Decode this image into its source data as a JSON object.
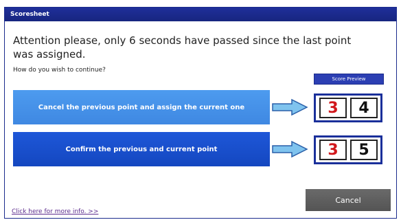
{
  "window": {
    "title": "Scoresheet"
  },
  "message": {
    "text": "Attention please, only 6 seconds have passed since the last point was assigned.",
    "question": "How do you wish to continue?"
  },
  "score_preview": {
    "label": "Score Preview",
    "option_cancel": {
      "left": "3",
      "right": "4"
    },
    "option_confirm": {
      "left": "3",
      "right": "5"
    }
  },
  "buttons": {
    "cancel_previous": "Cancel the previous point and assign the current one",
    "confirm": "Confirm the previous and current point",
    "cancel": "Cancel"
  },
  "links": {
    "more_info": "Click here for more info. >>"
  },
  "colors": {
    "titlebar": "#1f2f9a",
    "button_light_blue": "#4d9bef",
    "button_dark_blue": "#1e57d8",
    "score_red": "#d1181c",
    "arrow_fill": "#7fc3ee",
    "cancel_gray": "#5f5f5f"
  },
  "icons": {
    "arrow": "right-arrow-icon"
  }
}
